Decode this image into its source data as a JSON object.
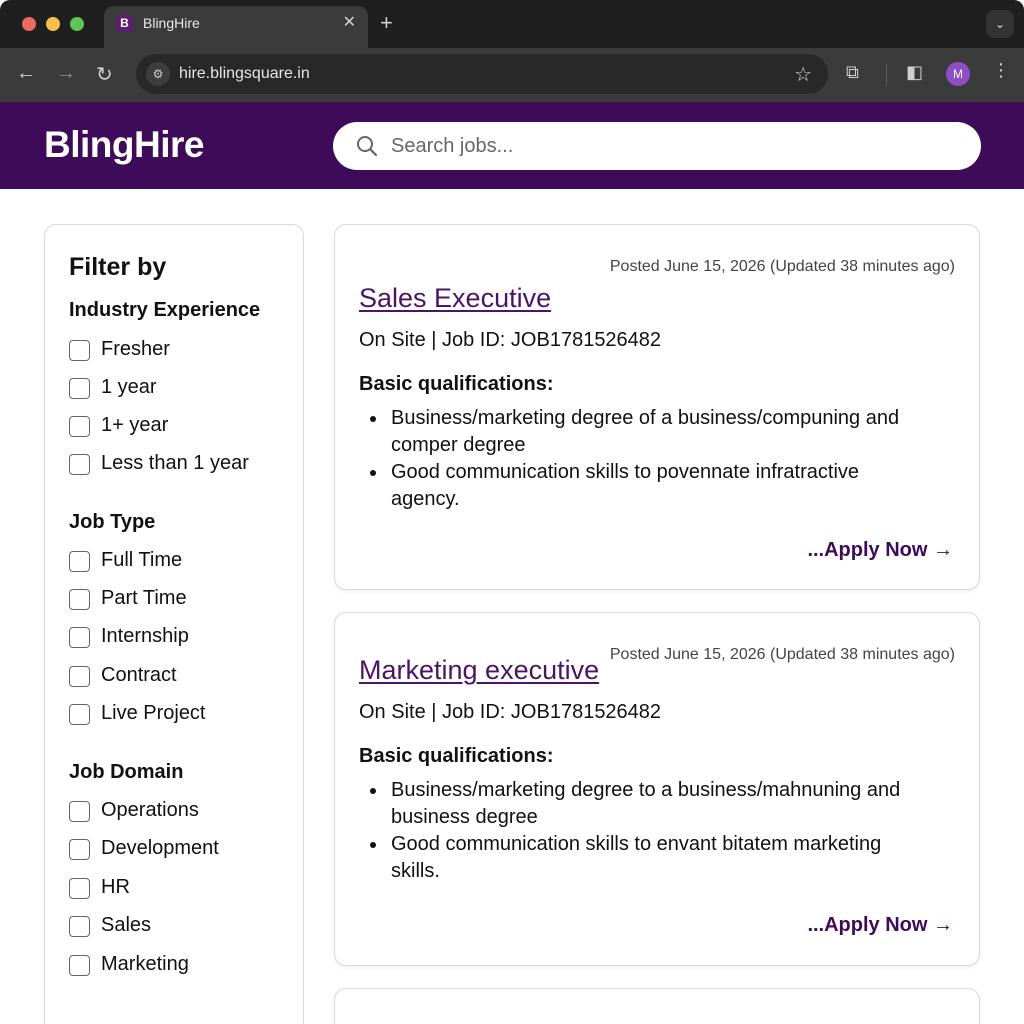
{
  "browser": {
    "tab_title": "BlingHire",
    "tab_favicon_letter": "B",
    "url": "hire.blingsquare.in",
    "profile_initial": "M"
  },
  "site": {
    "logo": "BlingHire",
    "search_placeholder": "Search jobs..."
  },
  "sidebar": {
    "title": "Filter by",
    "groups": [
      {
        "title": "Industry Experience",
        "options": [
          "Fresher",
          "1 year",
          "1+ year",
          "Less than 1 year"
        ]
      },
      {
        "title": "Job Type",
        "options": [
          "Full Time",
          "Part Time",
          "Internship",
          "Contract",
          "Live Project"
        ]
      },
      {
        "title": "Job Domain",
        "options": [
          "Operations",
          "Development",
          "HR",
          "Sales",
          "Marketing"
        ]
      }
    ]
  },
  "jobs": [
    {
      "posted": "Posted June 15, 2026 (Updated 38 minutes ago)",
      "title": "Sales Executive",
      "meta": "On Site | Job ID: JOB1781526482",
      "qualifications_title": "Basic qualifications:",
      "bullets": [
        "Business/marketing degree of a business/compuning and comper degree",
        "Good communication skills to povennate infratractive agency."
      ],
      "apply": "...Apply Now →"
    },
    {
      "posted": "Posted June 15, 2026 (Updated 38 minutes ago)",
      "title": "Marketing executive",
      "meta": "On Site | Job ID: JOB1781526482",
      "qualifications_title": "Basic qualifications:",
      "bullets": [
        "Business/marketing degree to a business/mahnuning and business degree",
        "Good communication skills to envant bitatem marketing skills."
      ],
      "apply": "...Apply Now →"
    }
  ],
  "colors": {
    "brand": "#3e0b58",
    "link": "#4b1466"
  },
  "icons": {
    "back": "arrow-left-icon",
    "forward": "arrow-right-icon",
    "reload": "reload-icon",
    "search": "search-icon",
    "bookmark": "star-icon",
    "extensions": "puzzle-icon",
    "sidepanel": "sidepanel-icon",
    "menu": "kebab-icon"
  }
}
